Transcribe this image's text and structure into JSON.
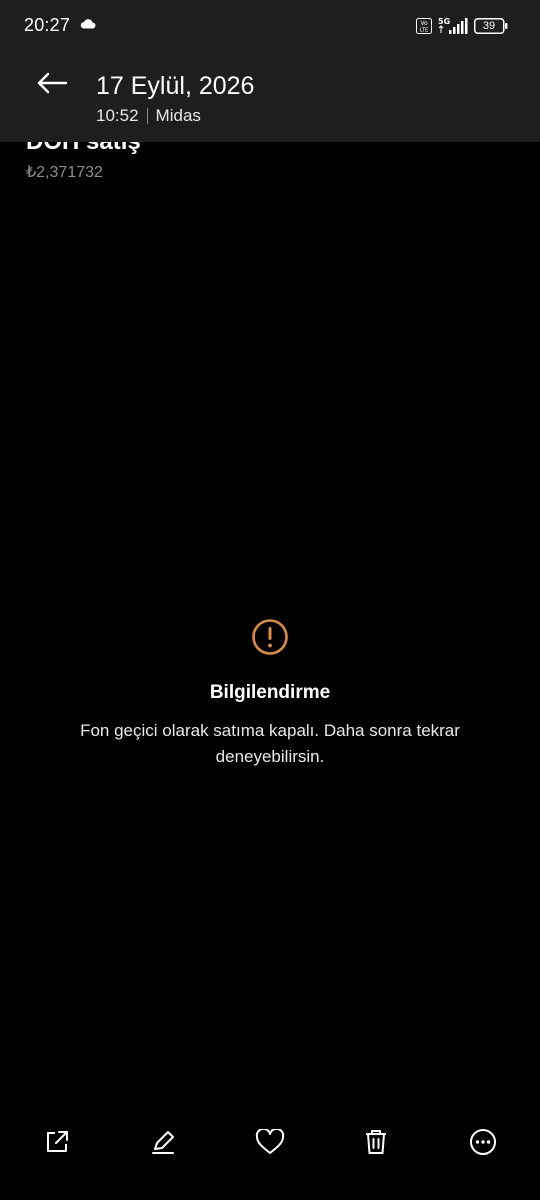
{
  "status_bar": {
    "time": "20:27",
    "network": "5G",
    "battery": "39",
    "icons": [
      "cloud-icon",
      "volte-icon",
      "signal-icon",
      "battery-icon"
    ]
  },
  "header": {
    "date": "17 Eylül, 2026",
    "time": "10:52",
    "source": "Midas",
    "back_icon": "arrow-left-icon"
  },
  "content": {
    "title": "DOH satış",
    "price": "₺2,371732"
  },
  "info": {
    "icon": "warning-circle-icon",
    "accent_color": "#e08a3c",
    "title": "Bilgilendirme",
    "message": "Fon geçici olarak satıma kapalı. Daha sonra tekrar deneyebilirsin."
  },
  "toolbar": {
    "items": [
      "share-icon",
      "edit-icon",
      "favorite-icon",
      "delete-icon",
      "more-icon"
    ]
  }
}
